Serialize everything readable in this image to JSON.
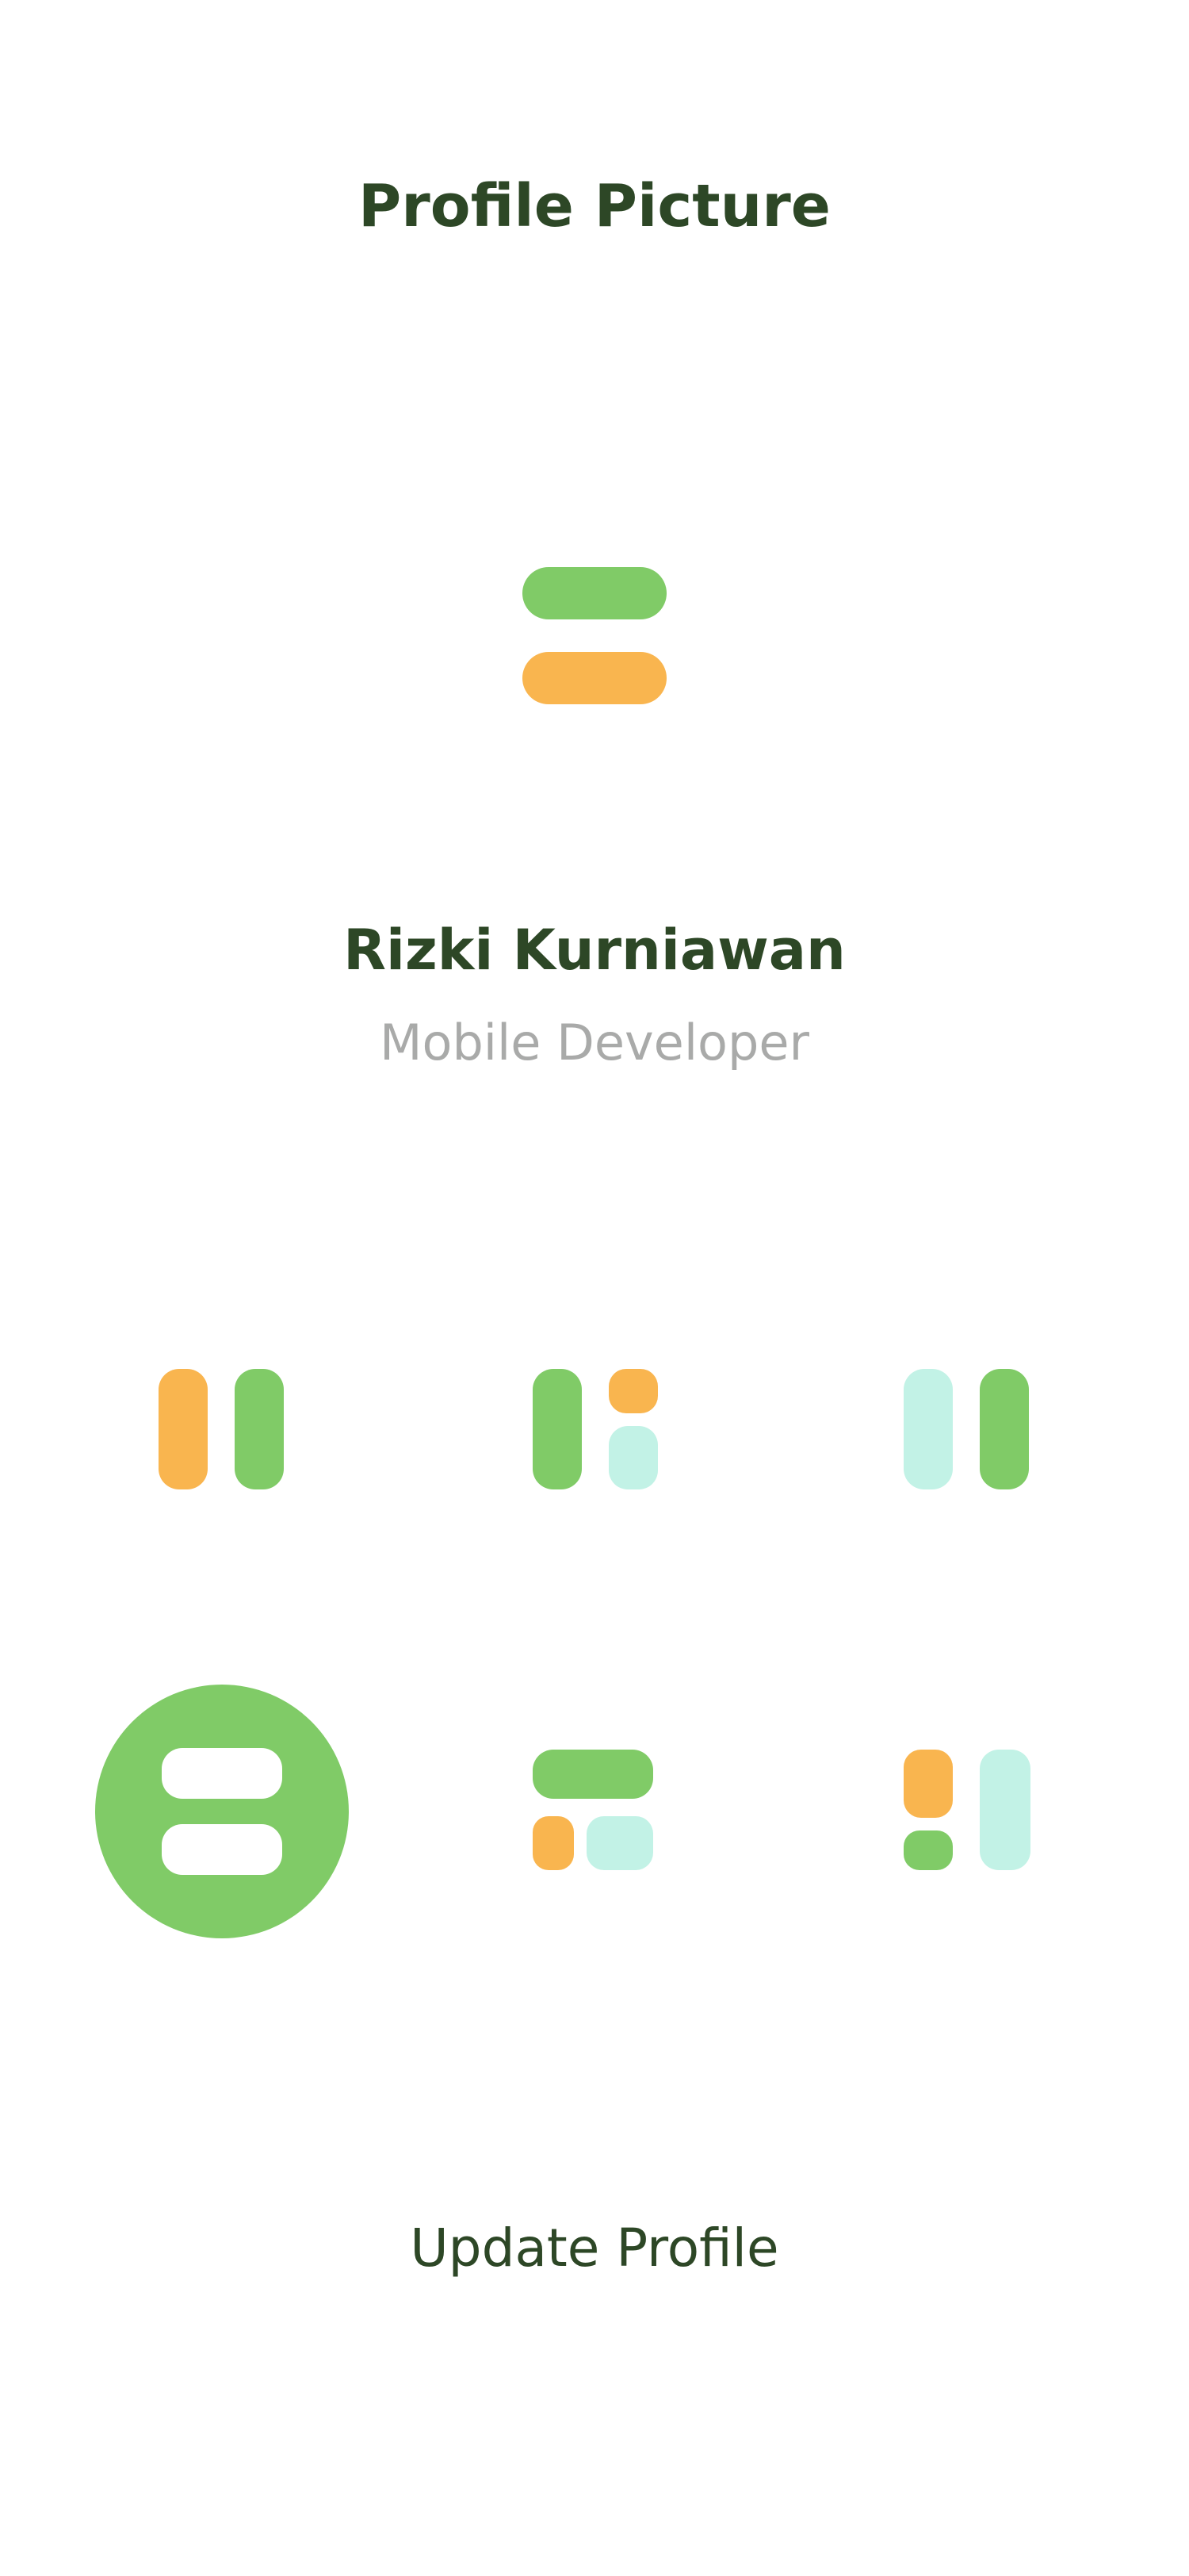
{
  "header": {
    "title": "Profile Picture"
  },
  "profile": {
    "name": "Rizki Kurniawan",
    "role": "Mobile Developer"
  },
  "avatar_options": [
    {
      "id": "avatar-1",
      "icon": "two-vertical-bars-orange-green-icon",
      "selected": false
    },
    {
      "id": "avatar-2",
      "icon": "bar-and-two-tiles-green-orange-mint-icon",
      "selected": false
    },
    {
      "id": "avatar-3",
      "icon": "two-vertical-bars-mint-green-icon",
      "selected": false
    },
    {
      "id": "avatar-4",
      "icon": "two-horizontal-bars-white-icon",
      "selected": true
    },
    {
      "id": "avatar-5",
      "icon": "wide-bar-and-two-tiles-green-orange-mint-icon",
      "selected": false
    },
    {
      "id": "avatar-6",
      "icon": "two-tiles-and-tall-bar-orange-green-mint-icon",
      "selected": false
    }
  ],
  "actions": {
    "update_label": "Update Profile"
  },
  "colors": {
    "green": "#80cb67",
    "orange": "#f9b54f",
    "mint": "#c2f2e6",
    "title_text": "#2d4726",
    "muted_text": "#a9aaa9",
    "white": "#ffffff"
  }
}
